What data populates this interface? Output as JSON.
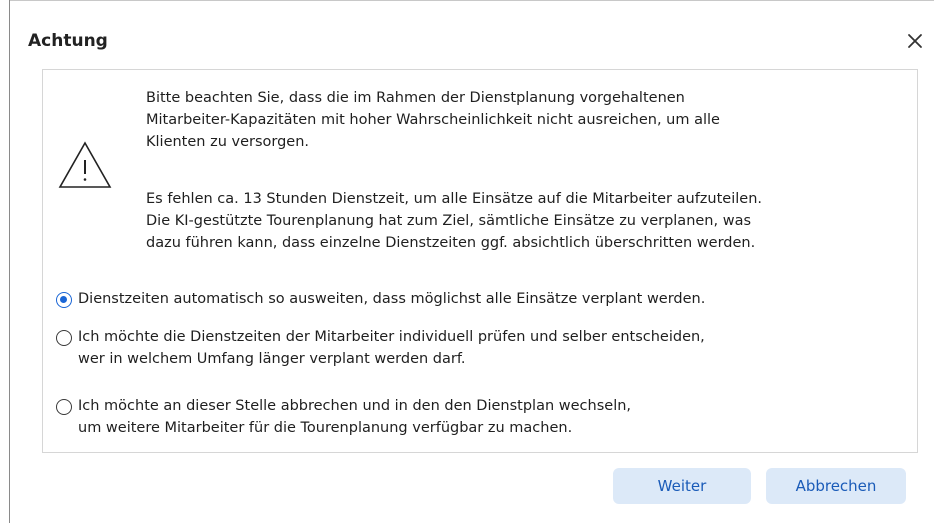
{
  "dialog": {
    "title": "Achtung",
    "close_icon": "close-icon"
  },
  "message": {
    "icon": "warning-triangle-icon",
    "paragraph1": [
      "Bitte beachten Sie, dass die im Rahmen der Dienstplanung vorgehaltenen",
      "Mitarbeiter-Kapazitäten mit hoher Wahrscheinlichkeit nicht ausreichen, um alle",
      "Klienten zu versorgen."
    ],
    "paragraph2": [
      "Es fehlen ca. 13 Stunden Dienstzeit, um alle Einsätze auf die Mitarbeiter aufzuteilen.",
      "Die KI-gestützte Tourenplanung hat zum Ziel, sämtliche Einsätze zu verplanen, was",
      "dazu führen kann, dass einzelne Dienstzeiten ggf. absichtlich überschritten werden."
    ]
  },
  "options": [
    {
      "selected": true,
      "lines": [
        "Dienstzeiten automatisch so ausweiten, dass möglichst alle Einsätze verplant werden."
      ]
    },
    {
      "selected": false,
      "lines": [
        "Ich möchte die Dienstzeiten der Mitarbeiter individuell prüfen und selber entscheiden,",
        "wer in welchem Umfang länger verplant werden darf."
      ]
    },
    {
      "selected": false,
      "lines": [
        "Ich möchte an dieser Stelle abbrechen und in den den Dienstplan wechseln,",
        "um weitere Mitarbeiter für die Tourenplanung verfügbar zu machen."
      ]
    }
  ],
  "buttons": {
    "continue_label": "Weiter",
    "cancel_label": "Abbrechen"
  },
  "colors": {
    "accent": "#1a66d6",
    "button_bg": "#dce9f8",
    "button_text": "#1a5bb8"
  }
}
